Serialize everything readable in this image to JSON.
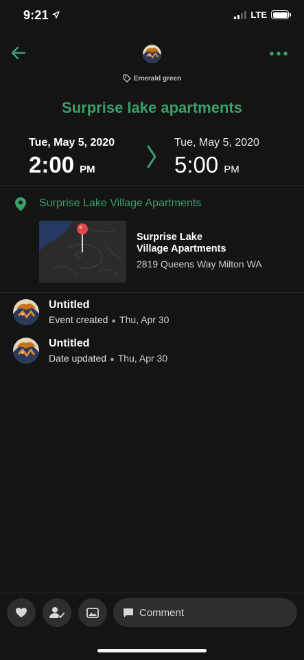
{
  "status_bar": {
    "time": "9:21",
    "network": "LTE"
  },
  "header": {
    "calendar_name": "Emerald green",
    "title": "Surprise lake apartments",
    "accent_color": "#3aa067"
  },
  "event": {
    "start": {
      "date": "Tue, May 5, 2020",
      "time": "2:00",
      "ampm": "PM"
    },
    "end": {
      "date": "Tue, May 5, 2020",
      "time": "5:00",
      "ampm": "PM"
    }
  },
  "location": {
    "name": "Surprise Lake Village Apartments",
    "map_title_line1": "Surprise Lake",
    "map_title_line2": "Village Apartments",
    "address": "2819 Queens Way Milton WA"
  },
  "activity": [
    {
      "title": "Untitled",
      "action": "Event created",
      "date": "Thu, Apr 30"
    },
    {
      "title": "Untitled",
      "action": "Date updated",
      "date": "Thu, Apr 30"
    }
  ],
  "toolbar": {
    "comment_placeholder": "Comment",
    "icons": [
      "heart-icon",
      "person-check-icon",
      "image-icon",
      "comment-icon"
    ]
  }
}
